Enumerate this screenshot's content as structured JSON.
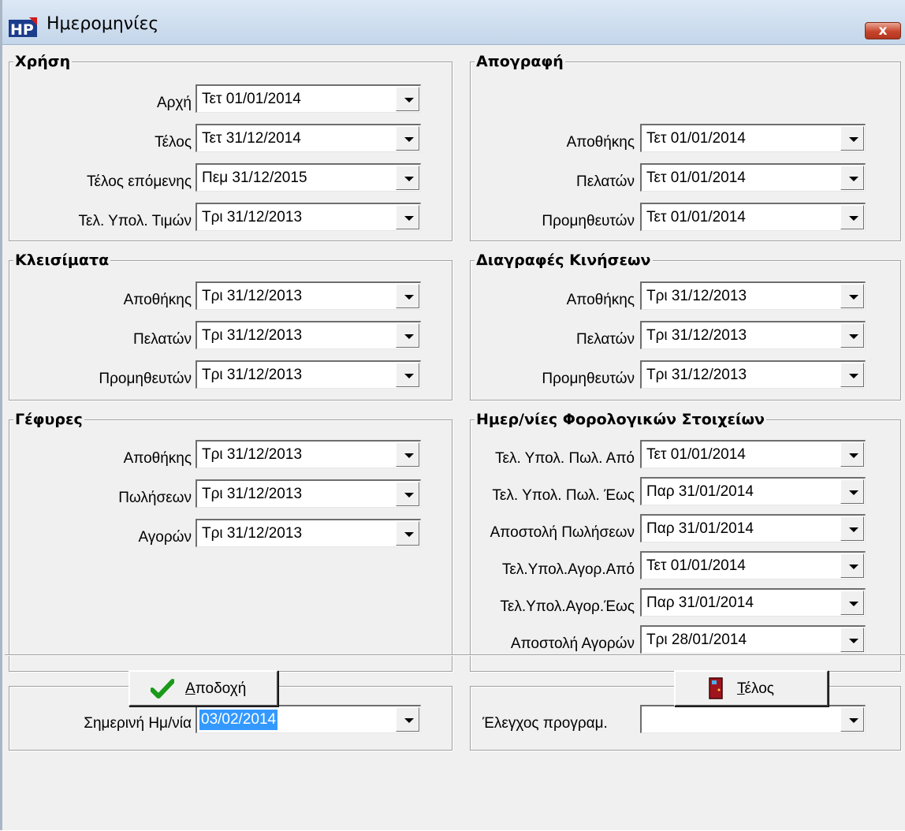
{
  "window": {
    "title": "Ημερομηνίες",
    "close_label": "x"
  },
  "xrisi": {
    "title": "Χρήση",
    "rows": [
      {
        "label": "Αρχή",
        "value": "Τετ 01/01/2014"
      },
      {
        "label": "Τέλος",
        "value": "Τετ 31/12/2014"
      },
      {
        "label": "Τέλος επόμενης",
        "value": "Πεμ 31/12/2015"
      },
      {
        "label": "Τελ. Υπολ. Τιμών",
        "value": "Τρι 31/12/2013"
      }
    ]
  },
  "apografi": {
    "title": "Απογραφή",
    "rows": [
      {
        "label": "Αποθήκης",
        "value": "Τετ 01/01/2014"
      },
      {
        "label": "Πελατών",
        "value": "Τετ 01/01/2014"
      },
      {
        "label": "Προμηθευτών",
        "value": "Τετ 01/01/2014"
      }
    ]
  },
  "kleisimata": {
    "title": "Κλεισίματα",
    "rows": [
      {
        "label": "Αποθήκης",
        "value": "Τρι 31/12/2013"
      },
      {
        "label": "Πελατών",
        "value": "Τρι 31/12/2013"
      },
      {
        "label": "Προμηθευτών",
        "value": "Τρι 31/12/2013"
      }
    ]
  },
  "diagrafes": {
    "title": "Διαγραφές Κινήσεων",
    "rows": [
      {
        "label": "Αποθήκης",
        "value": "Τρι 31/12/2013"
      },
      {
        "label": "Πελατών",
        "value": "Τρι 31/12/2013"
      },
      {
        "label": "Προμηθευτών",
        "value": "Τρι 31/12/2013"
      }
    ]
  },
  "gefyres": {
    "title": "Γέφυρες",
    "rows": [
      {
        "label": "Αποθήκης",
        "value": "Τρι 31/12/2013"
      },
      {
        "label": "Πωλήσεων",
        "value": "Τρι 31/12/2013"
      },
      {
        "label": "Αγορών",
        "value": "Τρι 31/12/2013"
      }
    ]
  },
  "forologika": {
    "title": "Ημερ/νίες Φορολογικών Στοιχείων",
    "rows": [
      {
        "label": "Τελ. Υπολ. Πωλ. Από",
        "value": "Τετ 01/01/2014"
      },
      {
        "label": "Τελ. Υπολ. Πωλ. Έως",
        "value": "Παρ 31/01/2014"
      },
      {
        "label": "Αποστολή Πωλήσεων",
        "value": "Παρ 31/01/2014"
      },
      {
        "label": "Τελ.Υπολ.Αγορ.Από",
        "value": "Τετ 01/01/2014"
      },
      {
        "label": "Τελ.Υπολ.Αγορ.Έως",
        "value": "Παρ 31/01/2014"
      },
      {
        "label": "Αποστολή Αγορών",
        "value": "Τρι 28/01/2014"
      }
    ]
  },
  "today": {
    "label": "Σημερινή Ημ/νία",
    "value": "03/02/2014"
  },
  "program_check": {
    "label": "Έλεγχος προγραμ.",
    "value": ""
  },
  "buttons": {
    "accept_mnemonic": "Α",
    "accept_rest": "ποδοχή",
    "end_mnemonic": "Τ",
    "end_rest": "έλος"
  },
  "colors": {
    "selection": "#3399ff",
    "check_green": "#1a9a1a",
    "door_red": "#a0141e"
  }
}
